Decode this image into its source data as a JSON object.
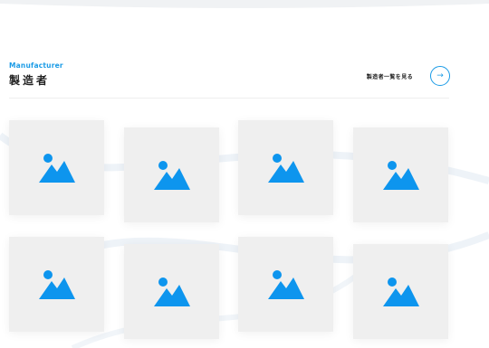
{
  "section": {
    "eyebrow": "Manufacturer",
    "title": "製造者",
    "view_all_label": "製造者一覧を見る",
    "arrow_glyph": "→"
  },
  "colors": {
    "accent": "#1a9be6",
    "card_bg": "#efefef",
    "placeholder_icon": "#0d95ee",
    "heading": "#222222"
  },
  "cards": [
    {
      "icon": "image-placeholder-icon"
    },
    {
      "icon": "image-placeholder-icon"
    },
    {
      "icon": "image-placeholder-icon"
    },
    {
      "icon": "image-placeholder-icon"
    },
    {
      "icon": "image-placeholder-icon"
    },
    {
      "icon": "image-placeholder-icon"
    },
    {
      "icon": "image-placeholder-icon"
    },
    {
      "icon": "image-placeholder-icon"
    }
  ]
}
